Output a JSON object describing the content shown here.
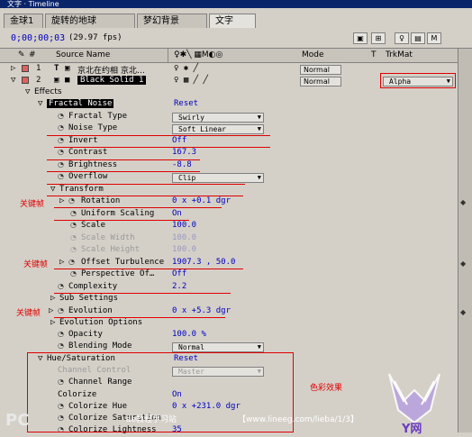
{
  "window": {
    "title": "文字 · Timeline"
  },
  "tabs": [
    "金球1",
    "旋转的地球",
    "梦幻背景",
    "文字"
  ],
  "time": {
    "timecode": "0;00;00;03",
    "fps": "(29.97 fps)"
  },
  "columns": {
    "source_name": "Source Name",
    "mode": "Mode",
    "t": "T",
    "trkmat": "TrkMat"
  },
  "layers": [
    {
      "num": "1",
      "name": "京北在约相 京北…",
      "mode": "Normal"
    },
    {
      "num": "2",
      "name": "Black Solid 1",
      "mode": "Normal",
      "trkmat": "Alpha"
    }
  ],
  "effects_label": "Effects",
  "props": [
    {
      "label": "Fractal Noise",
      "value": "Reset"
    },
    {
      "label": "Fractal Type",
      "value": "Swirly"
    },
    {
      "label": "Noise Type",
      "value": "Soft Linear"
    },
    {
      "label": "Invert",
      "value": "Off"
    },
    {
      "label": "Contrast",
      "value": "167.3"
    },
    {
      "label": "Brightness",
      "value": "-8.8"
    },
    {
      "label": "Overflow",
      "value": "Clip"
    },
    {
      "label": "Transform",
      "value": ""
    },
    {
      "label": "Rotation",
      "value": "0 x +0.1 dgr"
    },
    {
      "label": "Uniform Scaling",
      "value": "On"
    },
    {
      "label": "Scale",
      "value": "100.0"
    },
    {
      "label": "Scale Width",
      "value": "100.0"
    },
    {
      "label": "Scale Height",
      "value": "100.0"
    },
    {
      "label": "Offset Turbulence",
      "value": "1907.3 , 50.0"
    },
    {
      "label": "Perspective Of…",
      "value": "Off"
    },
    {
      "label": "Complexity",
      "value": "2.2"
    },
    {
      "label": "Sub Settings",
      "value": ""
    },
    {
      "label": "Evolution",
      "value": "0 x +5.3 dgr"
    },
    {
      "label": "Evolution Options",
      "value": ""
    },
    {
      "label": "Opacity",
      "value": "100.0 %"
    },
    {
      "label": "Blending Mode",
      "value": "Normal"
    },
    {
      "label": "Hue/Saturation",
      "value": "Reset"
    },
    {
      "label": "Channel Control",
      "value": "Master"
    },
    {
      "label": "Channel Range",
      "value": ""
    },
    {
      "label": "Colorize",
      "value": "On"
    },
    {
      "label": "Colorize Hue",
      "value": "0 x +231.0 dgr"
    },
    {
      "label": "Colorize Saturation",
      "value": ""
    },
    {
      "label": "Colorize Lightness",
      "value": "35"
    }
  ],
  "annotations": {
    "keyframe": "关键帧",
    "color_effect": "色彩效果"
  },
  "watermark": {
    "left": "PC",
    "middle": "ae教程学习站",
    "url": "【www.lineeg.com/lieba/1/3】",
    "logo_text": "Y网"
  },
  "colors": {
    "accent": "#0000c0",
    "annotation_red": "#e00000",
    "panel_bg": "#d4d0c8"
  }
}
